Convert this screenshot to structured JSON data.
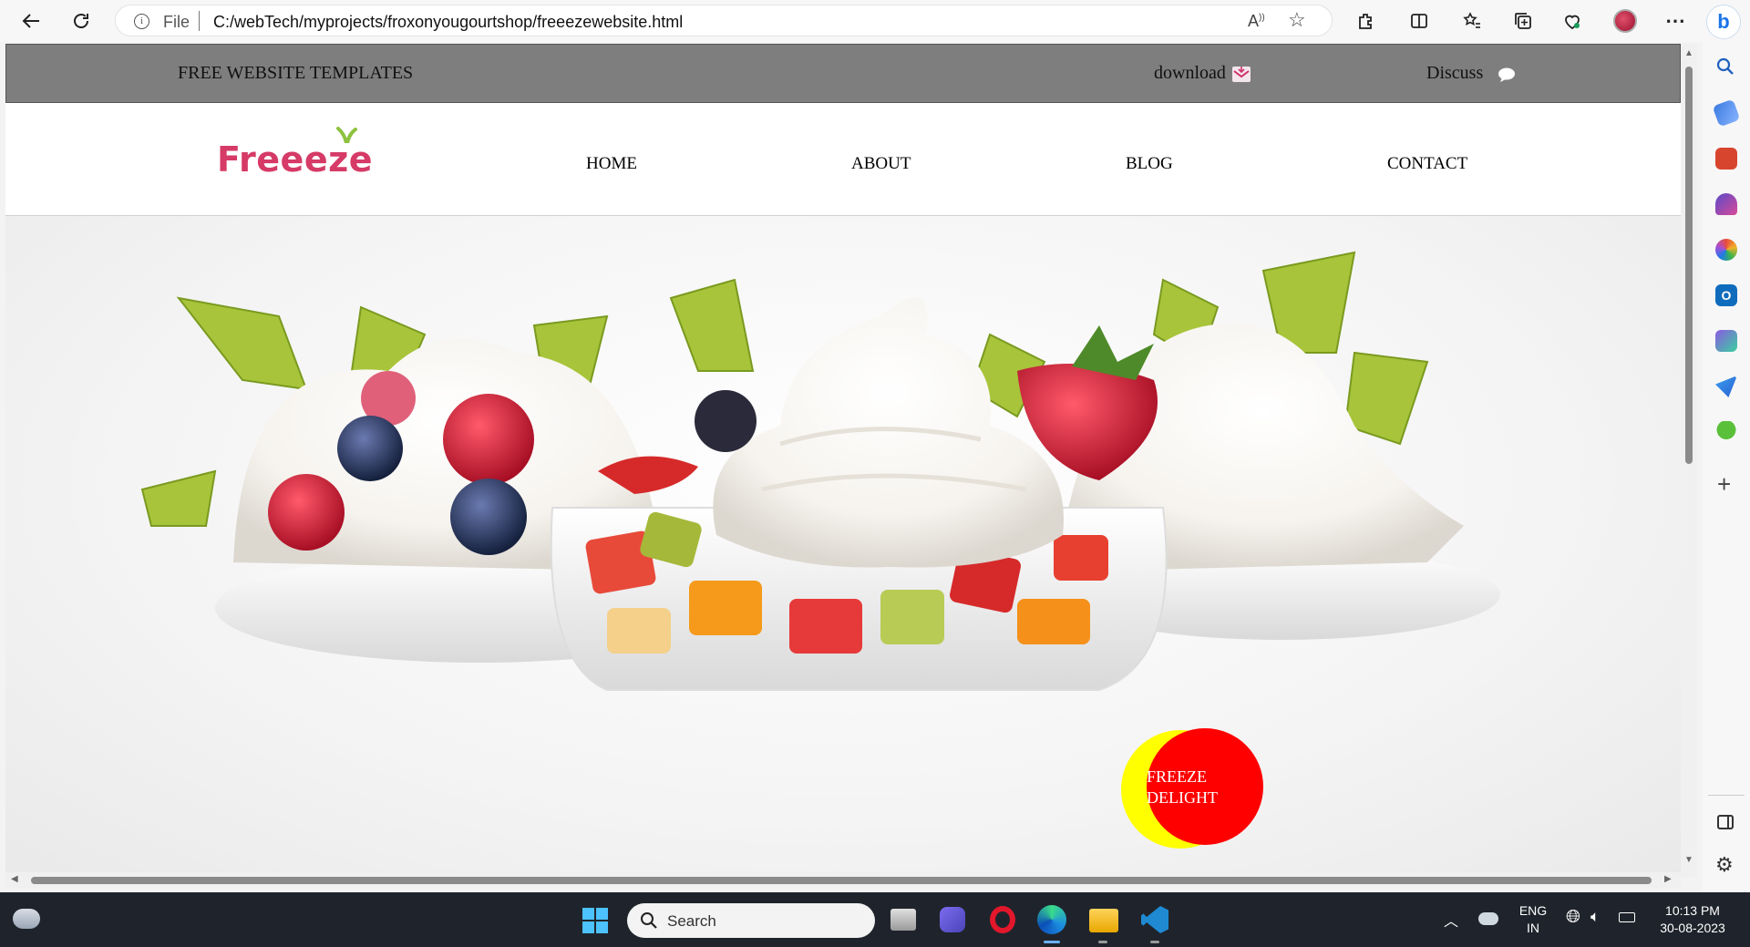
{
  "browser": {
    "file_label": "File",
    "url": "C:/webTech/myprojects/froxonyougourtshop/freeezewebsite.html"
  },
  "page": {
    "topbar": {
      "left_text": "FREE WEBSITE TEMPLATES",
      "download_label": "download",
      "discuss_label": "Discuss"
    },
    "logo_text": "Freeeze",
    "nav": [
      "HOME",
      "ABOUT",
      "BLOG",
      "CONTACT"
    ],
    "badge": {
      "line1": "FREEZE",
      "line2": "DELIGHT"
    }
  },
  "taskbar": {
    "search_label": "Search",
    "lang_line1": "ENG",
    "lang_line2": "IN",
    "time": "10:13 PM",
    "date": "30-08-2023"
  },
  "colors": {
    "brand": "#d63a66",
    "badge_red": "#ff0000",
    "badge_yellow": "#ffff00",
    "topbar_gray": "#7e7e7e"
  }
}
